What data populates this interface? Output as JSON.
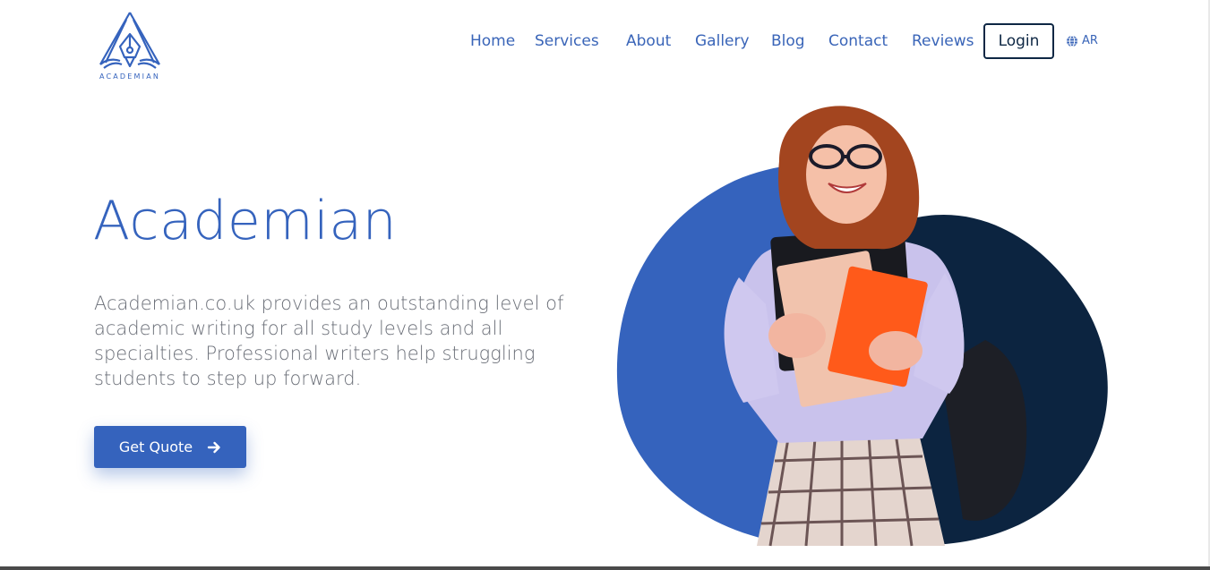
{
  "brand": {
    "logo_text": "ACADEMIAN",
    "colors": {
      "primary": "#3563bd",
      "dark": "#0e2744",
      "text_muted": "#6b6f78"
    }
  },
  "nav": {
    "items": [
      {
        "label": "Home"
      },
      {
        "label": "Services"
      },
      {
        "label": "About"
      },
      {
        "label": "Gallery"
      },
      {
        "label": "Blog"
      },
      {
        "label": "Contact"
      },
      {
        "label": "Reviews"
      }
    ],
    "login_label": "Login",
    "language": {
      "icon": "globe-icon",
      "label": "AR"
    }
  },
  "hero": {
    "title": "Academian",
    "description": "Academian.co.uk provides an outstanding level of academic writing for all study levels and all specialties. Professional writers help struggling students to step up forward.",
    "cta_label": "Get Quote",
    "cta_icon": "arrow-right-icon"
  }
}
